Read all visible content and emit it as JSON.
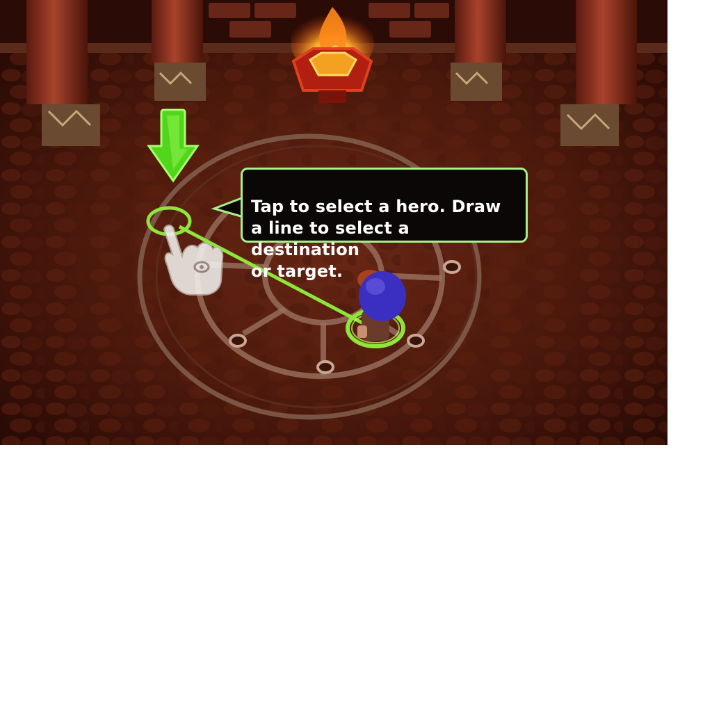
{
  "tutorial": {
    "instruction_text": "Tap to select a hero. Draw\na line to select a destination\nor target."
  },
  "colors": {
    "highlight_green": "#8ee63a",
    "tooltip_border": "#a8f08a",
    "tooltip_background": "#0b0706",
    "hero_cloak": "#3a2fc0"
  },
  "icons": {
    "pointer_arrow": "arrow-down-icon",
    "tap_hand": "hand-pointer-icon"
  }
}
